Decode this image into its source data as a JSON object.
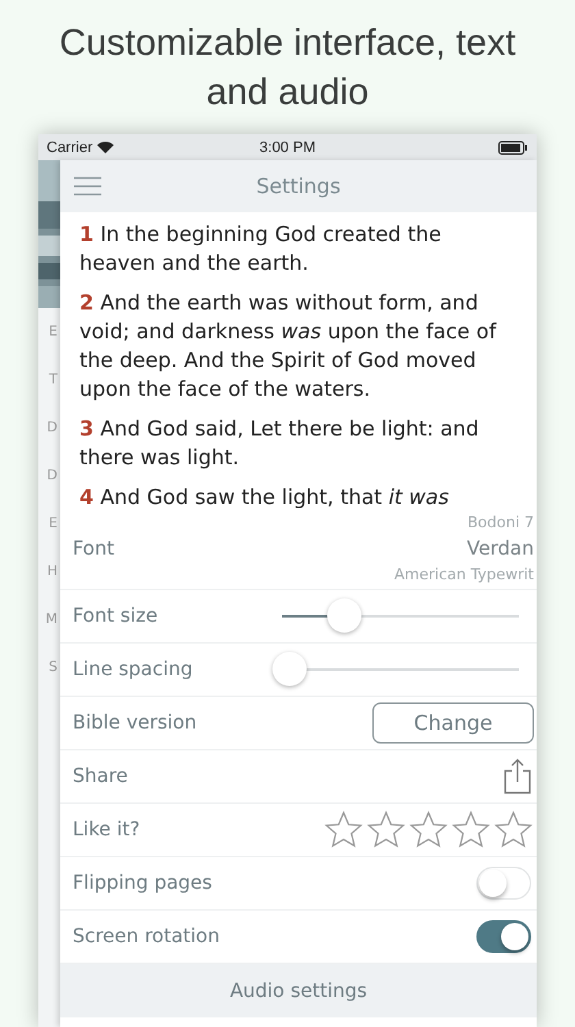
{
  "headline": "Customizable interface, text and audio",
  "status_bar": {
    "carrier": "Carrier",
    "time": "3:00 PM"
  },
  "side_menu": {
    "items": [
      "E",
      "T",
      "D",
      "D",
      "E",
      "H",
      "M",
      "S"
    ]
  },
  "nav_bar": {
    "title": "Settings"
  },
  "verses": [
    {
      "number": "1",
      "text": "In the beginning God created the heaven and the earth."
    },
    {
      "number": "2",
      "text": "And the earth was without form, and void; and darkness *was* upon the face of the deep. And the Spirit of God moved upon the face of the waters."
    },
    {
      "number": "3",
      "text": "And God said, Let there be light: and there was light."
    },
    {
      "number": "4",
      "text": "And God saw the light, that *it was*"
    }
  ],
  "settings": [
    {
      "kind": "picker",
      "label": "Font",
      "options": [
        {
          "label": "Bodoni 7",
          "selected": false
        },
        {
          "label": "Verdan",
          "selected": true
        },
        {
          "label": "American Typewrit",
          "selected": false
        }
      ]
    },
    {
      "kind": "slider",
      "label": "Font size",
      "level": 0.26
    },
    {
      "kind": "slider",
      "label": "Line spacing",
      "level": 0.03
    },
    {
      "kind": "button",
      "label": "Bible version",
      "button": "Change"
    },
    {
      "kind": "share",
      "label": "Share"
    },
    {
      "kind": "rating",
      "label": "Like it?",
      "stars": 0
    },
    {
      "kind": "toggle",
      "label": "Flipping pages",
      "on": false
    },
    {
      "kind": "toggle",
      "label": "Screen rotation",
      "on": true
    },
    {
      "kind": "header",
      "label": "Audio settings"
    }
  ]
}
